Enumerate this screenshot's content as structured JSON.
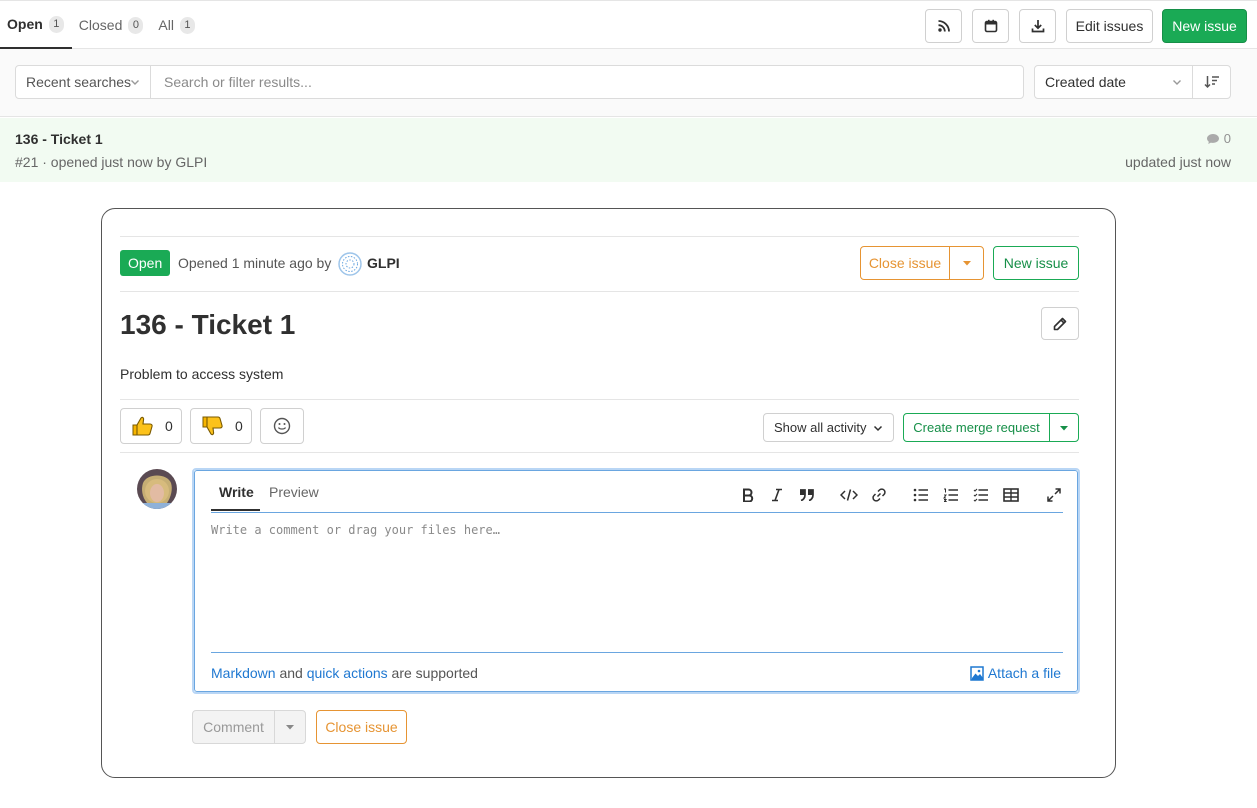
{
  "tabs": [
    {
      "label": "Open",
      "count": "1"
    },
    {
      "label": "Closed",
      "count": "0"
    },
    {
      "label": "All",
      "count": "1"
    }
  ],
  "actions": {
    "rss_icon": "rss-icon",
    "calendar_icon": "calendar-icon",
    "export_icon": "download-icon",
    "edit_issues": "Edit issues",
    "new_issue": "New issue"
  },
  "filter": {
    "recent_searches": "Recent searches",
    "search_placeholder": "Search or filter results...",
    "sort_by": "Created date"
  },
  "issue_list": [
    {
      "title": "136 - Ticket 1",
      "meta": "#21 · opened just now by GLPI",
      "comments": "0",
      "updated": "updated just now"
    }
  ],
  "issue": {
    "status": "Open",
    "opened_text": "Opened 1 minute ago by",
    "author": "GLPI",
    "close_issue": "Close issue",
    "new_issue": "New issue",
    "title": "136 - Ticket 1",
    "description": "Problem to access system",
    "thumbs_up": "0",
    "thumbs_down": "0",
    "activity_filter": "Show all activity",
    "create_mr": "Create merge request"
  },
  "editor": {
    "tab_write": "Write",
    "tab_preview": "Preview",
    "placeholder": "Write a comment or drag your files here…",
    "footer_markdown": "Markdown",
    "footer_and": " and ",
    "footer_quick_actions": "quick actions",
    "footer_supported": " are supported",
    "attach": "Attach a file",
    "comment_button": "Comment",
    "close_issue_button": "Close issue"
  },
  "colors": {
    "green": "#1aaa55",
    "orange": "#e69433",
    "link": "#1f78d1",
    "row_highlight": "#f2fbf2"
  }
}
